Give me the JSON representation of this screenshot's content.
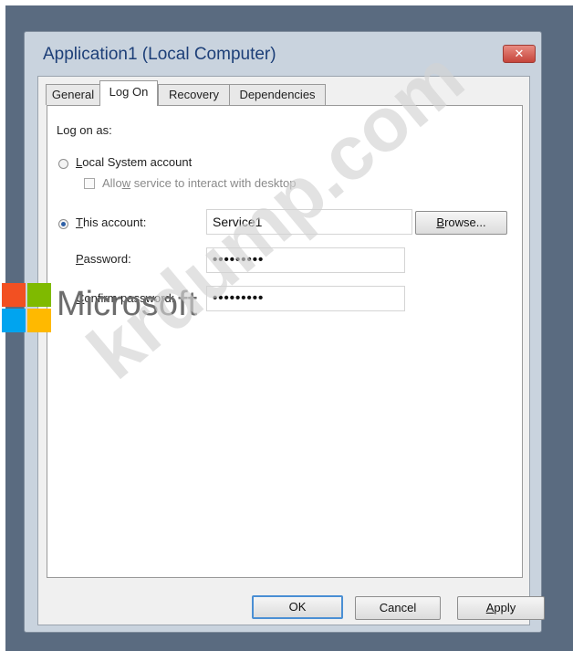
{
  "window": {
    "title": "Application1 (Local Computer)",
    "close_glyph": "✕"
  },
  "tabs": [
    {
      "label": "General",
      "active": false
    },
    {
      "label": "Log On",
      "active": true
    },
    {
      "label": "Recovery",
      "active": false
    },
    {
      "label": "Dependencies",
      "active": false
    }
  ],
  "logon": {
    "heading": "Log on as:",
    "local_system": {
      "label_u": "L",
      "label_rest": "ocal System account",
      "selected": false
    },
    "interact": {
      "label_pre": "Allo",
      "label_u": "w",
      "label_post": " service to interact with desktop",
      "checked": false,
      "enabled": false
    },
    "this_account": {
      "label_u": "T",
      "label_rest": "his account:",
      "selected": true,
      "value": "Service1"
    },
    "browse_button": {
      "label_u": "B",
      "label_rest": "rowse..."
    },
    "password": {
      "label_u": "P",
      "label_rest": "assword:",
      "value": "•••••••••"
    },
    "confirm": {
      "label_u": "C",
      "label_rest": "onfirm password:",
      "value": "•••••••••"
    }
  },
  "buttons": {
    "ok": "OK",
    "cancel": "Cancel",
    "apply_u": "A",
    "apply_rest": "pply"
  },
  "watermarks": {
    "logo_text": "Microsoft",
    "site_text": "krdump.com",
    "logo_colors": [
      "#f25022",
      "#7fba00",
      "#00a4ef",
      "#ffb900"
    ]
  },
  "colors": {
    "frame": "#5a6b80",
    "title_text": "#1d3f78",
    "default_button_border": "#4a8fd4"
  }
}
